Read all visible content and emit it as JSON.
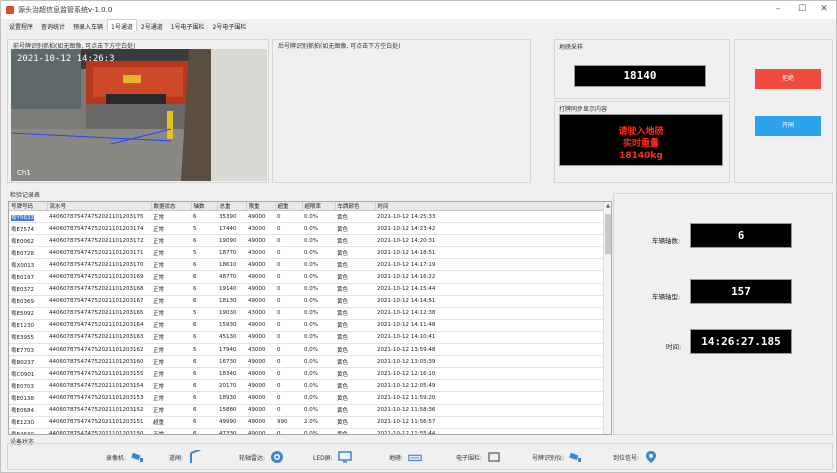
{
  "window": {
    "title": "源头治超信息监管系统v-1.0.0"
  },
  "tabs": [
    "设置程序",
    "查询统计",
    "预录入车辆",
    "1号通道",
    "2号通道",
    "1号电子围栏",
    "2号电子围栏"
  ],
  "active_tab_index": 3,
  "front_camera": {
    "label": "前号牌识别抓拍(如无图像, 可点击下方空白处)"
  },
  "rear_camera": {
    "label": "后号牌识别抓拍(如无图像, 可点击下方空白处)"
  },
  "weight_sample": {
    "label": "地磅采样",
    "value": "18140"
  },
  "led_sync": {
    "label": "打牌同步显示内容",
    "lines": [
      "请驶入地磅",
      "实时重量",
      "18140kg"
    ]
  },
  "buttons": {
    "reject": "拒绝",
    "open": "开闸",
    "reject_color": "#f04a3a",
    "open_color": "#2ca3ea"
  },
  "records": {
    "label": "检验记录表",
    "columns": [
      "号牌号码",
      "流水号",
      "数据状态",
      "轴数",
      "总重",
      "限重",
      "超重",
      "超限率",
      "车牌颜色",
      "时间"
    ],
    "rows": [
      [
        "粤Y5633",
        "440607875474752021101203175",
        "正常",
        "6",
        "35390",
        "49000",
        "0",
        "0.0%",
        "黄色",
        "2021-10-12 14:25:33"
      ],
      [
        "粤E7574",
        "440607875474752021101203174",
        "正常",
        "5",
        "17440",
        "43000",
        "0",
        "0.0%",
        "黄色",
        "2021-10-12 14:23:42"
      ],
      [
        "粤E0062",
        "440607875474752021101203172",
        "正常",
        "6",
        "19090",
        "49000",
        "0",
        "0.0%",
        "黄色",
        "2021-10-12 14:20:31"
      ],
      [
        "粤E0728",
        "440607875474752021101203171",
        "正常",
        "5",
        "18770",
        "43000",
        "0",
        "0.0%",
        "黄色",
        "2021-10-12 14:18:51"
      ],
      [
        "粤X0013",
        "440607875474752021101203170",
        "正常",
        "6",
        "18610",
        "49000",
        "0",
        "0.0%",
        "黄色",
        "2021-10-12 14:17:19"
      ],
      [
        "粤E0197",
        "440607875474752021101203169",
        "正常",
        "6",
        "48770",
        "49000",
        "0",
        "0.0%",
        "黄色",
        "2021-10-12 14:16:22"
      ],
      [
        "粤E0372",
        "440607875474752021101203168",
        "正常",
        "6",
        "19140",
        "49000",
        "0",
        "0.0%",
        "黄色",
        "2021-10-12 14:15:44"
      ],
      [
        "粤E0369",
        "440607875474752021101203167",
        "正常",
        "6",
        "18130",
        "49000",
        "0",
        "0.0%",
        "黄色",
        "2021-10-12 14:14:51"
      ],
      [
        "粤E5092",
        "440607875474752021101203165",
        "正常",
        "5",
        "19030",
        "43000",
        "0",
        "0.0%",
        "黄色",
        "2021-10-12 14:12:38"
      ],
      [
        "粤E1230",
        "440607875474752021101203164",
        "正常",
        "6",
        "15930",
        "49000",
        "0",
        "0.0%",
        "黄色",
        "2021-10-12 14:11:48"
      ],
      [
        "粤E3955",
        "440607875474752021101203163",
        "正常",
        "6",
        "45130",
        "49000",
        "0",
        "0.0%",
        "黄色",
        "2021-10-12 14:10:41"
      ],
      [
        "粤E7703",
        "440607875474752021101203162",
        "正常",
        "5",
        "17940",
        "43000",
        "0",
        "0.0%",
        "黄色",
        "2021-10-12 13:59:48"
      ],
      [
        "粤B0237",
        "440607875474752021101203160",
        "正常",
        "6",
        "16730",
        "49000",
        "0",
        "0.0%",
        "黄色",
        "2021-10-12 13:05:39"
      ],
      [
        "粤C0901",
        "440607875474752021101203155",
        "正常",
        "6",
        "18340",
        "49000",
        "0",
        "0.0%",
        "黄色",
        "2021-10-12 12:16:10"
      ],
      [
        "粤E0703",
        "440607875474752021101203154",
        "正常",
        "6",
        "20170",
        "49000",
        "0",
        "0.0%",
        "黄色",
        "2021-10-12 12:05:49"
      ],
      [
        "粤E0138",
        "440607875474752021101203153",
        "正常",
        "6",
        "18930",
        "49000",
        "0",
        "0.0%",
        "黄色",
        "2021-10-12 11:59:20"
      ],
      [
        "粤E0684",
        "440607875474752021101203152",
        "正常",
        "6",
        "15880",
        "49000",
        "0",
        "0.0%",
        "黄色",
        "2021-10-12 11:58:36"
      ],
      [
        "粤E1230",
        "440607875474752021101203151",
        "超重",
        "6",
        "49990",
        "49000",
        "990",
        "2.0%",
        "黄色",
        "2021-10-12 11:56:57"
      ],
      [
        "粤E4630",
        "440607875474752021101203150",
        "正常",
        "6",
        "47330",
        "49000",
        "0",
        "0.0%",
        "黄色",
        "2021-10-12 11:55:44"
      ]
    ]
  },
  "vehicle_info": {
    "axles_label": "车辆轴数:",
    "axles": "6",
    "type_label": "车辆轴型:",
    "type": "157",
    "time_label": "时间:",
    "time": "14:26:27.185"
  },
  "device_status": {
    "label": "设备状态",
    "items": [
      {
        "label": "录像机:",
        "icon": "camera-icon"
      },
      {
        "label": "道闸:",
        "icon": "barrier-icon"
      },
      {
        "label": "轮轴雷达:",
        "icon": "radar-icon"
      },
      {
        "label": "LED屏:",
        "icon": "monitor-icon"
      },
      {
        "label": "地磅:",
        "icon": "scale-icon"
      },
      {
        "label": "电子围栏:",
        "icon": "fence-icon"
      },
      {
        "label": "号牌识别仪:",
        "icon": "plate-camera-icon"
      },
      {
        "label": "到位信号:",
        "icon": "location-pin-icon"
      }
    ]
  }
}
